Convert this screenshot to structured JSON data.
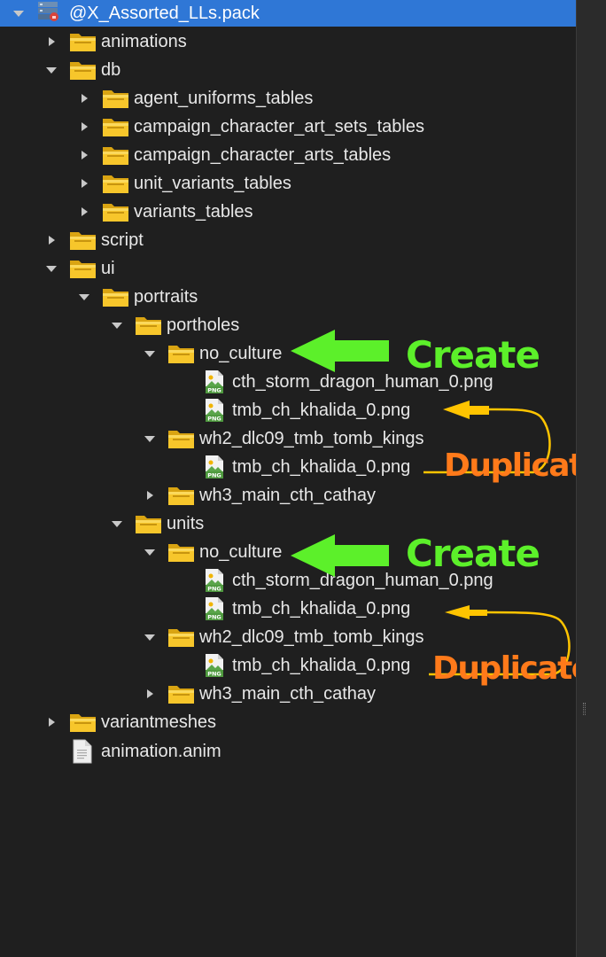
{
  "tree": {
    "root": "@X_Assorted_LLs.pack",
    "nodes": [
      {
        "label": "animations"
      },
      {
        "label": "db"
      },
      {
        "label": "agent_uniforms_tables"
      },
      {
        "label": "campaign_character_art_sets_tables"
      },
      {
        "label": "campaign_character_arts_tables"
      },
      {
        "label": "unit_variants_tables"
      },
      {
        "label": "variants_tables"
      },
      {
        "label": "script"
      },
      {
        "label": "ui"
      },
      {
        "label": "portraits"
      },
      {
        "label": "portholes"
      },
      {
        "label": "no_culture"
      },
      {
        "label": "cth_storm_dragon_human_0.png"
      },
      {
        "label": "tmb_ch_khalida_0.png"
      },
      {
        "label": "wh2_dlc09_tmb_tomb_kings"
      },
      {
        "label": "tmb_ch_khalida_0.png"
      },
      {
        "label": "wh3_main_cth_cathay"
      },
      {
        "label": "units"
      },
      {
        "label": "no_culture"
      },
      {
        "label": "cth_storm_dragon_human_0.png"
      },
      {
        "label": "tmb_ch_khalida_0.png"
      },
      {
        "label": "wh2_dlc09_tmb_tomb_kings"
      },
      {
        "label": "tmb_ch_khalida_0.png"
      },
      {
        "label": "wh3_main_cth_cathay"
      },
      {
        "label": "variantmeshes"
      },
      {
        "label": "animation.anim"
      }
    ]
  },
  "annotations": {
    "create_1": "Create",
    "duplicate_1": "Duplicate",
    "create_2": "Create",
    "duplicate_2": "Duplicate"
  },
  "colors": {
    "selection": "#2f77d6",
    "create": "#5cf02a",
    "duplicate": "#ff7a1a",
    "duplicate_arrow": "#ffc400",
    "folder": "#f5c518"
  }
}
